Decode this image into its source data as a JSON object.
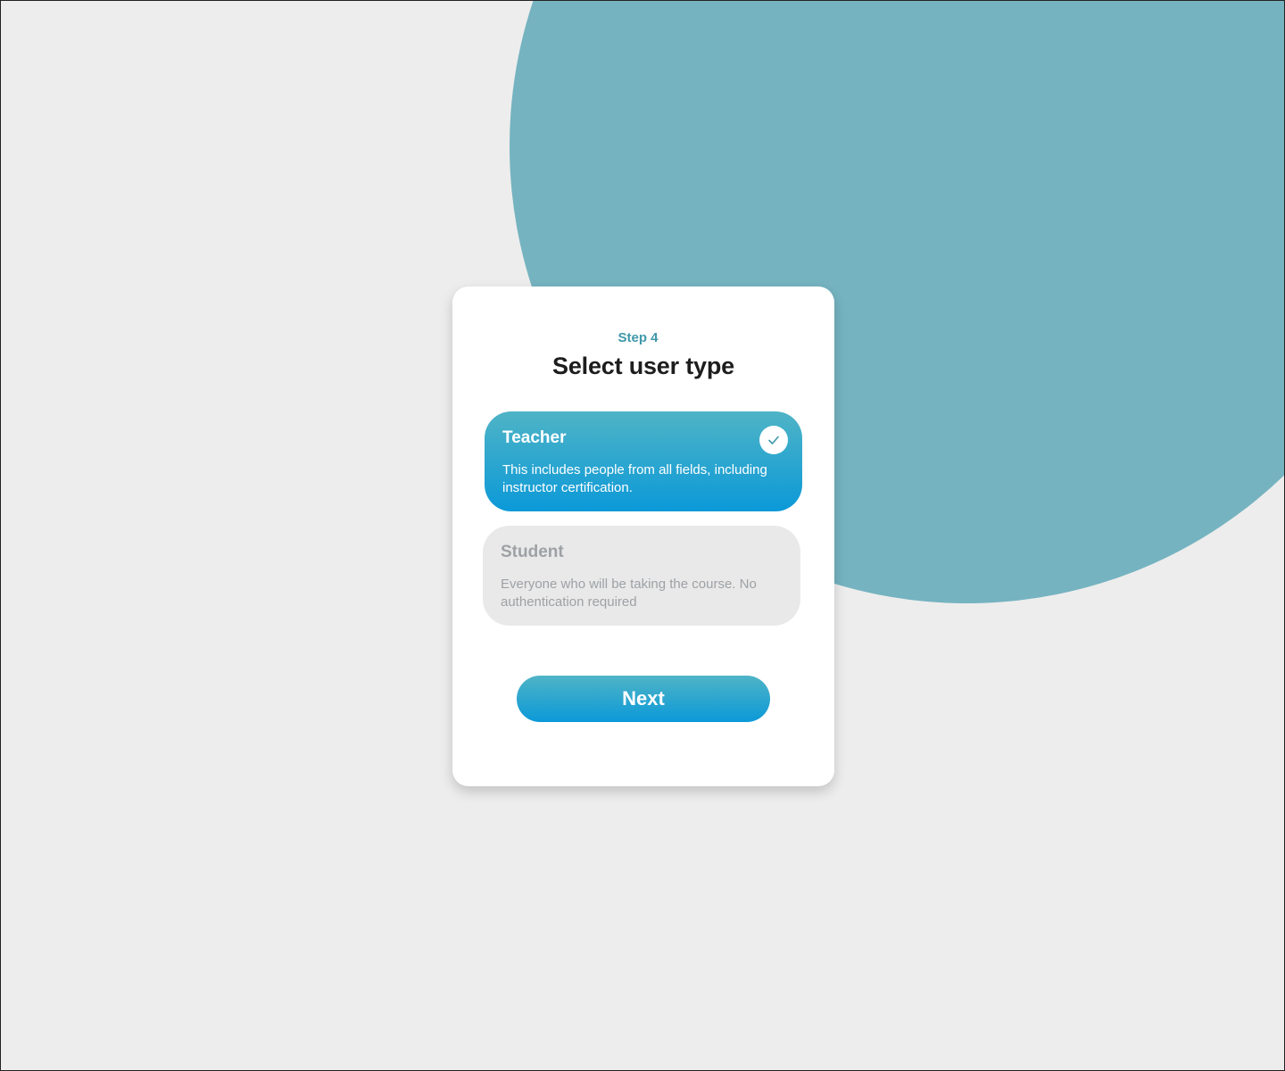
{
  "header": {
    "step": "Step 4",
    "title": "Select user type"
  },
  "options": [
    {
      "title": "Teacher",
      "description": "This includes people from all fields, including instructor certification.",
      "selected": true,
      "icon": "check-icon"
    },
    {
      "title": "Student",
      "description": "Everyone who will be taking the course. No authentication required",
      "selected": false
    }
  ],
  "actions": {
    "next_label": "Next"
  },
  "colors": {
    "background": "#ededed",
    "decor_circle": "#75b3c0",
    "accent_text": "#3e98a9",
    "gradient_top": "#4fb4c6",
    "gradient_bottom": "#0b99d8",
    "unselected_bg": "#e9e9e9",
    "unselected_text": "#9ea1a5"
  }
}
